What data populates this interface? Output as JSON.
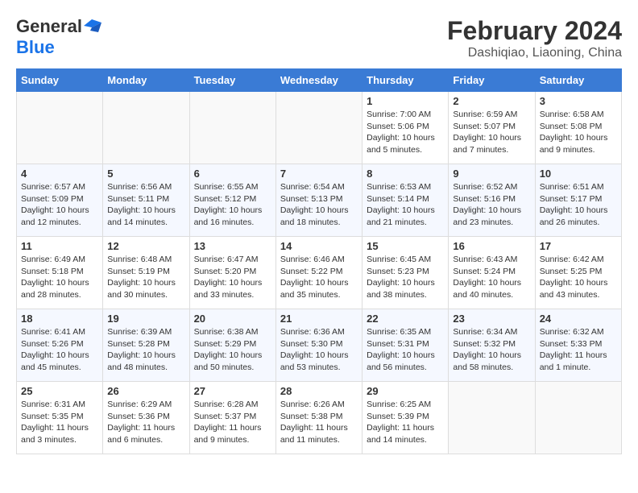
{
  "logo": {
    "line1": "General",
    "line2": "Blue"
  },
  "header": {
    "month": "February 2024",
    "location": "Dashiqiao, Liaoning, China"
  },
  "weekdays": [
    "Sunday",
    "Monday",
    "Tuesday",
    "Wednesday",
    "Thursday",
    "Friday",
    "Saturday"
  ],
  "weeks": [
    [
      {
        "day": "",
        "info": ""
      },
      {
        "day": "",
        "info": ""
      },
      {
        "day": "",
        "info": ""
      },
      {
        "day": "",
        "info": ""
      },
      {
        "day": "1",
        "info": "Sunrise: 7:00 AM\nSunset: 5:06 PM\nDaylight: 10 hours\nand 5 minutes."
      },
      {
        "day": "2",
        "info": "Sunrise: 6:59 AM\nSunset: 5:07 PM\nDaylight: 10 hours\nand 7 minutes."
      },
      {
        "day": "3",
        "info": "Sunrise: 6:58 AM\nSunset: 5:08 PM\nDaylight: 10 hours\nand 9 minutes."
      }
    ],
    [
      {
        "day": "4",
        "info": "Sunrise: 6:57 AM\nSunset: 5:09 PM\nDaylight: 10 hours\nand 12 minutes."
      },
      {
        "day": "5",
        "info": "Sunrise: 6:56 AM\nSunset: 5:11 PM\nDaylight: 10 hours\nand 14 minutes."
      },
      {
        "day": "6",
        "info": "Sunrise: 6:55 AM\nSunset: 5:12 PM\nDaylight: 10 hours\nand 16 minutes."
      },
      {
        "day": "7",
        "info": "Sunrise: 6:54 AM\nSunset: 5:13 PM\nDaylight: 10 hours\nand 18 minutes."
      },
      {
        "day": "8",
        "info": "Sunrise: 6:53 AM\nSunset: 5:14 PM\nDaylight: 10 hours\nand 21 minutes."
      },
      {
        "day": "9",
        "info": "Sunrise: 6:52 AM\nSunset: 5:16 PM\nDaylight: 10 hours\nand 23 minutes."
      },
      {
        "day": "10",
        "info": "Sunrise: 6:51 AM\nSunset: 5:17 PM\nDaylight: 10 hours\nand 26 minutes."
      }
    ],
    [
      {
        "day": "11",
        "info": "Sunrise: 6:49 AM\nSunset: 5:18 PM\nDaylight: 10 hours\nand 28 minutes."
      },
      {
        "day": "12",
        "info": "Sunrise: 6:48 AM\nSunset: 5:19 PM\nDaylight: 10 hours\nand 30 minutes."
      },
      {
        "day": "13",
        "info": "Sunrise: 6:47 AM\nSunset: 5:20 PM\nDaylight: 10 hours\nand 33 minutes."
      },
      {
        "day": "14",
        "info": "Sunrise: 6:46 AM\nSunset: 5:22 PM\nDaylight: 10 hours\nand 35 minutes."
      },
      {
        "day": "15",
        "info": "Sunrise: 6:45 AM\nSunset: 5:23 PM\nDaylight: 10 hours\nand 38 minutes."
      },
      {
        "day": "16",
        "info": "Sunrise: 6:43 AM\nSunset: 5:24 PM\nDaylight: 10 hours\nand 40 minutes."
      },
      {
        "day": "17",
        "info": "Sunrise: 6:42 AM\nSunset: 5:25 PM\nDaylight: 10 hours\nand 43 minutes."
      }
    ],
    [
      {
        "day": "18",
        "info": "Sunrise: 6:41 AM\nSunset: 5:26 PM\nDaylight: 10 hours\nand 45 minutes."
      },
      {
        "day": "19",
        "info": "Sunrise: 6:39 AM\nSunset: 5:28 PM\nDaylight: 10 hours\nand 48 minutes."
      },
      {
        "day": "20",
        "info": "Sunrise: 6:38 AM\nSunset: 5:29 PM\nDaylight: 10 hours\nand 50 minutes."
      },
      {
        "day": "21",
        "info": "Sunrise: 6:36 AM\nSunset: 5:30 PM\nDaylight: 10 hours\nand 53 minutes."
      },
      {
        "day": "22",
        "info": "Sunrise: 6:35 AM\nSunset: 5:31 PM\nDaylight: 10 hours\nand 56 minutes."
      },
      {
        "day": "23",
        "info": "Sunrise: 6:34 AM\nSunset: 5:32 PM\nDaylight: 10 hours\nand 58 minutes."
      },
      {
        "day": "24",
        "info": "Sunrise: 6:32 AM\nSunset: 5:33 PM\nDaylight: 11 hours\nand 1 minute."
      }
    ],
    [
      {
        "day": "25",
        "info": "Sunrise: 6:31 AM\nSunset: 5:35 PM\nDaylight: 11 hours\nand 3 minutes."
      },
      {
        "day": "26",
        "info": "Sunrise: 6:29 AM\nSunset: 5:36 PM\nDaylight: 11 hours\nand 6 minutes."
      },
      {
        "day": "27",
        "info": "Sunrise: 6:28 AM\nSunset: 5:37 PM\nDaylight: 11 hours\nand 9 minutes."
      },
      {
        "day": "28",
        "info": "Sunrise: 6:26 AM\nSunset: 5:38 PM\nDaylight: 11 hours\nand 11 minutes."
      },
      {
        "day": "29",
        "info": "Sunrise: 6:25 AM\nSunset: 5:39 PM\nDaylight: 11 hours\nand 14 minutes."
      },
      {
        "day": "",
        "info": ""
      },
      {
        "day": "",
        "info": ""
      }
    ]
  ]
}
